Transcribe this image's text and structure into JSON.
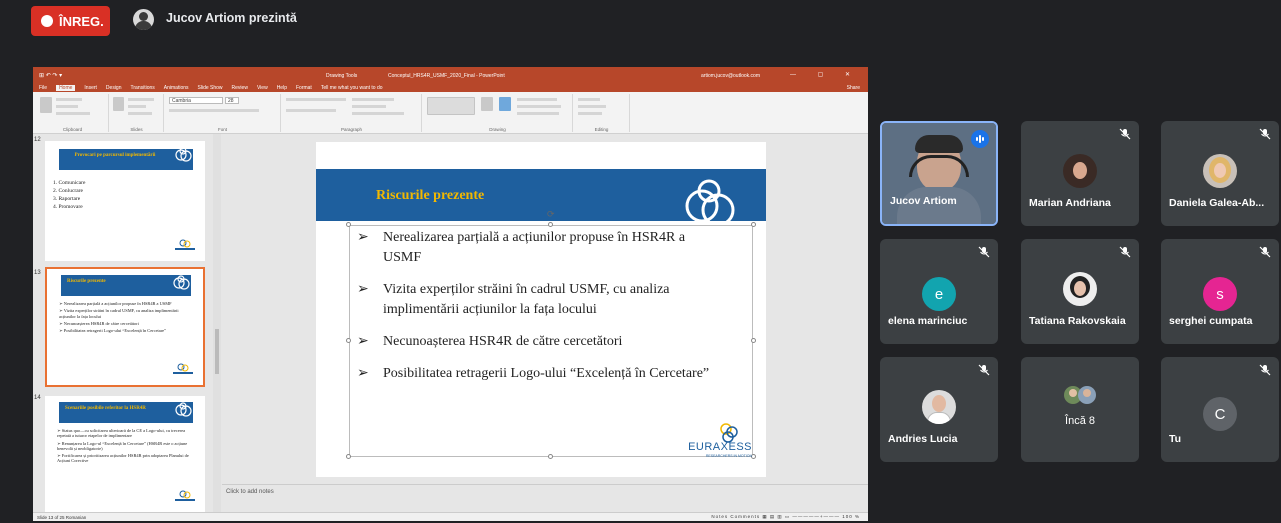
{
  "meet": {
    "rec_label": "ÎNREG.",
    "presenter_text": "Jucov Artiom prezintă"
  },
  "powerpoint": {
    "qat": "⊞ ↶ ↷ ▾",
    "context": "Drawing Tools",
    "filename": "Conceptul_HRS4R_USMF_2020_Final - PowerPoint",
    "account": "artiom.jucov@outlook.com",
    "window_controls": "— ▢ ✕",
    "tabs": [
      "File",
      "Home",
      "Insert",
      "Design",
      "Transitions",
      "Animations",
      "Slide Show",
      "Review",
      "View",
      "Help",
      "Format",
      "Tell me what you want to do"
    ],
    "share": "Share",
    "ribbon_groups": [
      "Clipboard",
      "Slides",
      "Font",
      "Paragraph",
      "Drawing",
      "Editing"
    ],
    "font_name": "Cambria",
    "font_size": "28",
    "thumb_numbers": [
      "12",
      "13",
      "14"
    ],
    "thumbs": [
      {
        "title": "Provocari pe parcursul implementării",
        "items": [
          "1. Comunicare",
          "2. Conlucrare",
          "3. Raportare",
          "4. Promovare"
        ]
      },
      {
        "title": "Riscurile prezente",
        "items": [
          "Nerealizarea parțială a acțiunilor propuse în HSR4R a USMF",
          "Vizita experților străini în cadrul USMF, cu analiza implimentării acțiunilor la fața locului",
          "Necunoașterea HSR4R de către cercetători",
          "Posibilitatea retragerii Logo-ului “Excelență în Cercetare”"
        ]
      },
      {
        "title": "Scenariile posibile referitor la HSR4R",
        "items": [
          "Status quo—cu solicitarea ulterioară de la CE a Logo-ului, cu trecerea repetată a tuturor etapelor de implimentare",
          "Renunțarea la Logo-ul “Excelență în Cercetare” (HSR4R este o acțiune benevolă și neobligatorie)",
          "Fortificarea și prioritizarea acțiunilor HSR4R prin adoptarea Planului de Acțiuni Corective"
        ]
      }
    ],
    "slide": {
      "title": "Riscurile prezente",
      "bullets": [
        "Nerealizarea parțială a acțiunilor propuse în HSR4R a USMF",
        "Vizita experților străini în cadrul USMF, cu analiza implimentării acțiunilor la fața locului",
        "Necunoașterea HSR4R de către cercetători",
        "Posibilitatea retragerii Logo-ului “Excelență în Cercetare”"
      ],
      "bullet_marker": "➢",
      "logo_text": "EURAXESS",
      "logo_sub": "RESEARCHERS IN MOTION"
    },
    "notes_placeholder": "Click to add notes",
    "status_left": "Slide 13 of 25    Romanian",
    "status_right": "Notes   Comments   ▦  ▤  ▥  ▭   —————+———   100 %"
  },
  "participants": [
    {
      "name": "Jucov Artiom",
      "speaking": true
    },
    {
      "name": "Marian Andriana"
    },
    {
      "name": "Daniela Galea-Ab..."
    },
    {
      "name": "elena marinciuc",
      "initial": "e",
      "color": "#12a4af"
    },
    {
      "name": "Tatiana Rakovskaia"
    },
    {
      "name": "serghei cumpata",
      "initial": "s",
      "color": "#e52592"
    },
    {
      "name": "Andries Lucia"
    },
    {
      "name": "Încă 8"
    },
    {
      "name": "Tu",
      "initial": "C",
      "color": "#5f6368"
    }
  ]
}
